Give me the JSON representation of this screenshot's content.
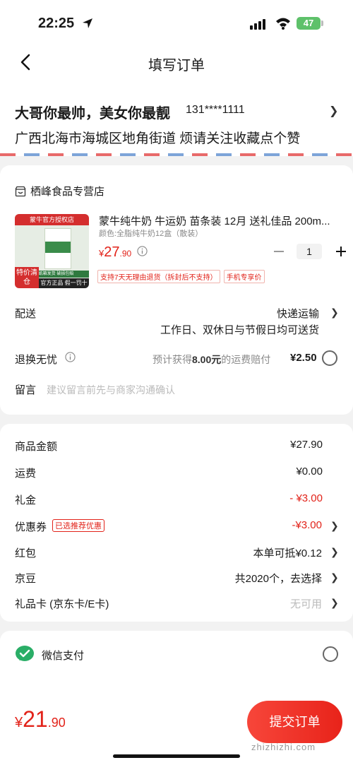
{
  "status_bar": {
    "time": "22:25",
    "battery": "47"
  },
  "nav": {
    "title": "填写订单"
  },
  "address": {
    "name": "大哥你最帅，美女你最靓",
    "phone": "131****1111",
    "detail": "广西北海市海城区地角街道 烦请关注收藏点个赞"
  },
  "store": {
    "name": "栖峰食品专营店",
    "product": {
      "image_top": "蒙牛官方授权店",
      "image_sub": "加厚纸箱发货 破损包赔",
      "image_badge": "特价清仓",
      "image_bottom": "官方正品 假一罚十",
      "title": "蒙牛纯牛奶 牛运奶 苗条装 12月 送礼佳品 200m...",
      "spec": "颜色:全脂纯牛奶12盒（散装）",
      "price_symbol": "¥",
      "price_int": "27",
      "price_dec": ".90",
      "quantity": "1",
      "tags": [
        "支持7天无理由退货（拆封后不支持）",
        "手机专享价"
      ]
    },
    "delivery": {
      "label": "配送",
      "method": "快递运输",
      "note": "工作日、双休日与节假日均可送货"
    },
    "return_worry_free": {
      "label": "退换无忧",
      "desc_prefix": "预计获得",
      "desc_amount": "8.00元",
      "desc_suffix": "的运费赔付",
      "price": "¥2.50"
    },
    "message": {
      "label": "留言",
      "placeholder": "建议留言前先与商家沟通确认"
    }
  },
  "summary": {
    "rows": [
      {
        "label": "商品金额",
        "value": "¥27.90"
      },
      {
        "label": "运费",
        "value": "¥0.00"
      },
      {
        "label": "礼金",
        "value": "- ¥3.00"
      },
      {
        "label": "优惠券",
        "tag": "已选推荐优惠",
        "value": "-¥3.00"
      },
      {
        "label": "红包",
        "value": "本单可抵¥0.12"
      },
      {
        "label": "京豆",
        "value": "共2020个，去选择"
      },
      {
        "label": "礼品卡 (京东卡/E卡)",
        "value": "无可用"
      }
    ]
  },
  "payment": {
    "option": "微信支付"
  },
  "footer": {
    "total_symbol": "¥",
    "total_int": "21",
    "total_dec": ".90",
    "submit": "提交订单",
    "watermark": "zhizhizhi.com"
  },
  "colors": {
    "accent": "#e2231a",
    "wechat_green": "#2aae67"
  }
}
